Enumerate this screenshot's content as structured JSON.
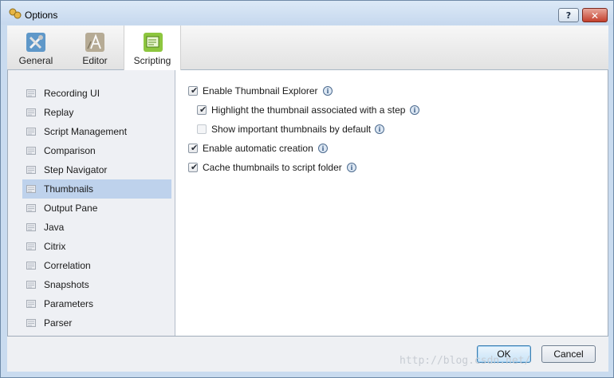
{
  "window": {
    "title": "Options",
    "help_label": "?",
    "close_label": "✕"
  },
  "tabs": [
    {
      "label": "General",
      "icon": "tools-icon"
    },
    {
      "label": "Editor",
      "icon": "font-icon"
    },
    {
      "label": "Scripting",
      "icon": "script-icon",
      "active": true
    }
  ],
  "sidebar": {
    "items": [
      {
        "label": "Recording UI"
      },
      {
        "label": "Replay"
      },
      {
        "label": "Script Management"
      },
      {
        "label": "Comparison"
      },
      {
        "label": "Step Navigator"
      },
      {
        "label": "Thumbnails",
        "selected": true
      },
      {
        "label": "Output Pane"
      },
      {
        "label": "Java"
      },
      {
        "label": "Citrix"
      },
      {
        "label": "Correlation"
      },
      {
        "label": "Snapshots"
      },
      {
        "label": "Parameters"
      },
      {
        "label": "Parser"
      }
    ]
  },
  "options": [
    {
      "label": "Enable Thumbnail Explorer",
      "checked": true
    },
    {
      "label": "Highlight the thumbnail associated with a step",
      "checked": true
    },
    {
      "label": "Show important thumbnails by default",
      "checked": false
    },
    {
      "label": "Enable automatic creation",
      "checked": true
    },
    {
      "label": "Cache thumbnails to script folder",
      "checked": true
    }
  ],
  "footer": {
    "ok_label": "OK",
    "cancel_label": "Cancel"
  },
  "watermark": "http://blog.csdn.net/",
  "colors": {
    "accent": "#bed2ec",
    "title_bar": "#c9dbef",
    "close": "#c4402d"
  }
}
